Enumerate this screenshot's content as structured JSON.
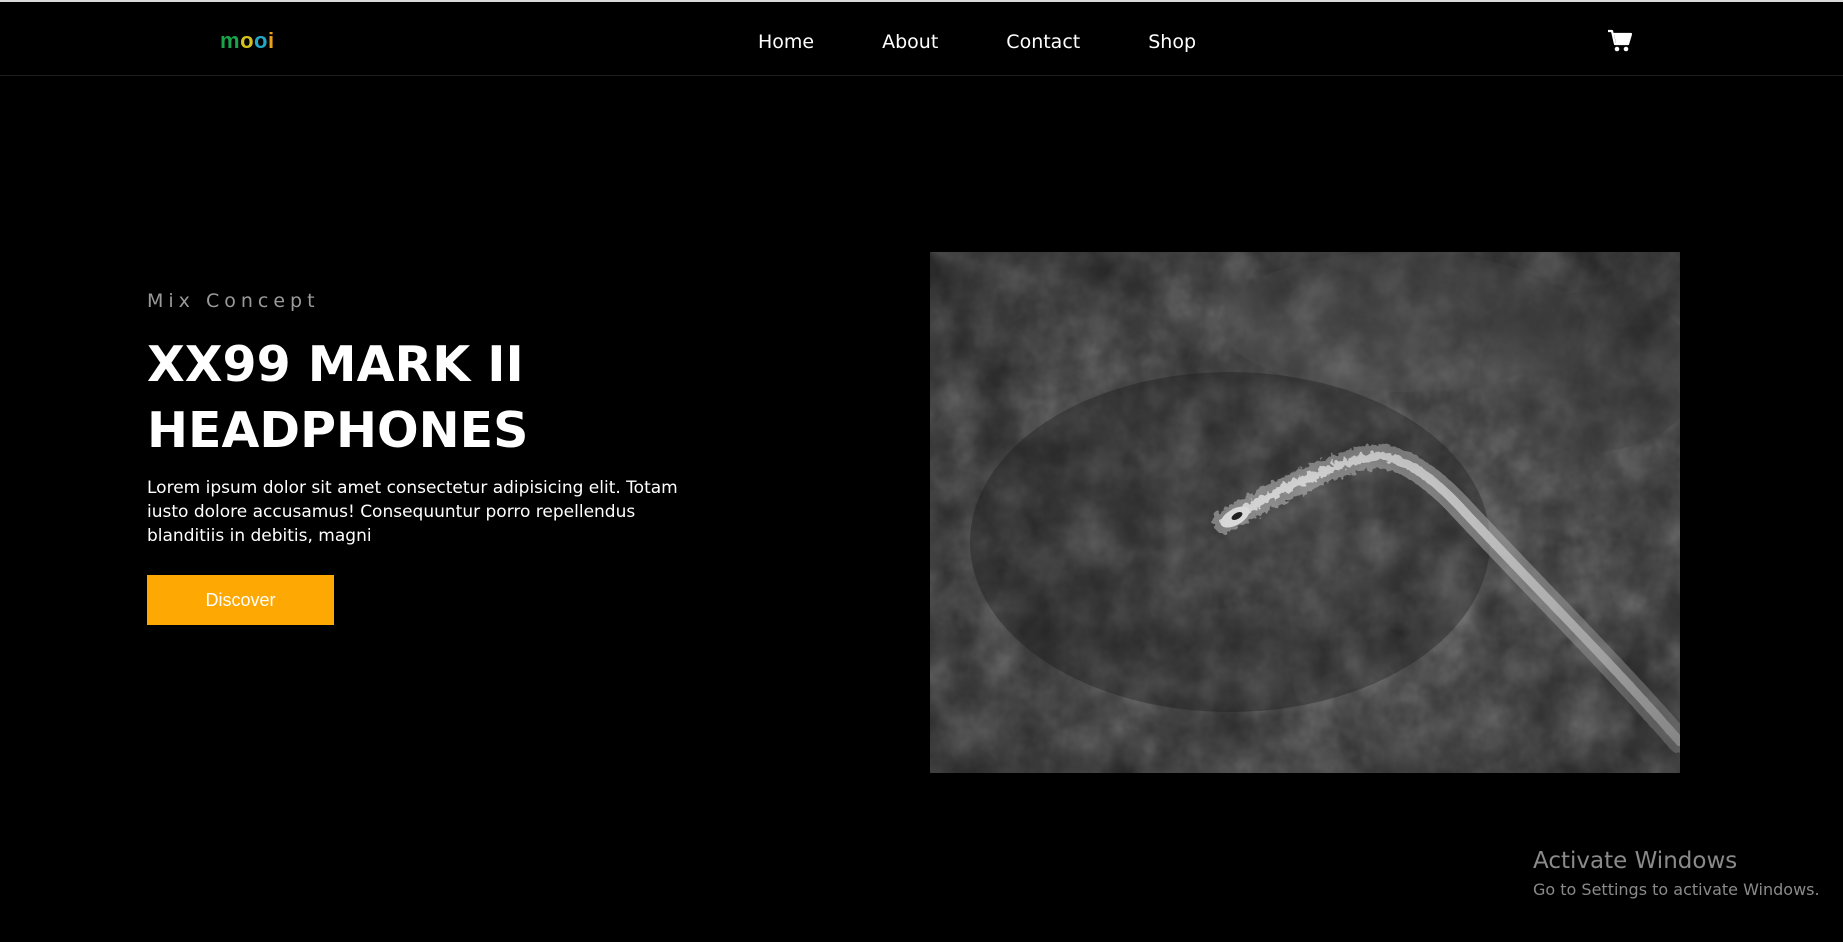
{
  "header": {
    "logo_letters": [
      "m",
      "o",
      "o",
      "i"
    ],
    "nav": [
      {
        "label": "Home"
      },
      {
        "label": "About"
      },
      {
        "label": "Contact"
      },
      {
        "label": "Shop"
      }
    ],
    "cart_icon": "shopping-cart-icon"
  },
  "hero": {
    "kicker": "Mix Concept",
    "title_line1": "XX99 MARK II",
    "title_line2": "HEADPHONES",
    "description": "Lorem ipsum dolor sit amet consectetur adipisicing elit. Totam iusto dolore accusamus! Consequuntur porro repellendus blanditiis in debitis, magni",
    "cta_label": "Discover",
    "image": "aerial-boat-wake-photo"
  },
  "colors": {
    "background": "#000000",
    "accent": "#fea803",
    "kicker": "#9a9a9a"
  },
  "overlay": {
    "title": "Activate Windows",
    "subtitle": "Go to Settings to activate Windows."
  }
}
